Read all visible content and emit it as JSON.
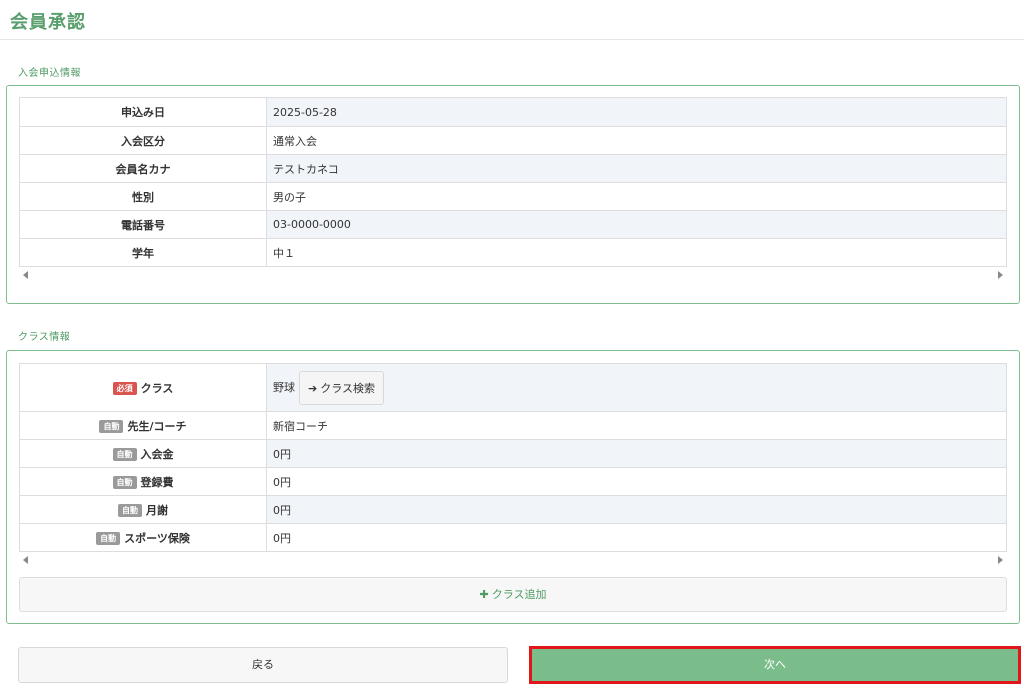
{
  "page": {
    "title": "会員承認"
  },
  "application": {
    "section_label": "入会申込情報",
    "rows": [
      {
        "label": "申込み日",
        "value": "2025-05-28"
      },
      {
        "label": "入会区分",
        "value": "通常入会"
      },
      {
        "label": "会員名カナ",
        "value": "テストカネコ"
      },
      {
        "label": "性別",
        "value": "男の子"
      },
      {
        "label": "電話番号",
        "value": "03-0000-0000"
      },
      {
        "label": "学年",
        "value": "中１"
      }
    ]
  },
  "class_info": {
    "section_label": "クラス情報",
    "badge_required": "必須",
    "badge_auto": "自動",
    "class_row": {
      "label": "クラス",
      "value": "野球",
      "search_button": "クラス検索"
    },
    "rows": [
      {
        "label": "先生/コーチ",
        "value": "新宿コーチ"
      },
      {
        "label": "入会金",
        "value": "0円"
      },
      {
        "label": "登録費",
        "value": "0円"
      },
      {
        "label": "月謝",
        "value": "0円"
      },
      {
        "label": "スポーツ保険",
        "value": "0円"
      }
    ],
    "add_button": "クラス追加"
  },
  "footer": {
    "back_label": "戻る",
    "next_label": "次へ"
  },
  "colors": {
    "accent": "#5a9f6e",
    "next_bg": "#7bbd8a",
    "highlight_border": "#e0161b",
    "required_badge": "#d9534f",
    "auto_badge": "#9a9a9a"
  }
}
